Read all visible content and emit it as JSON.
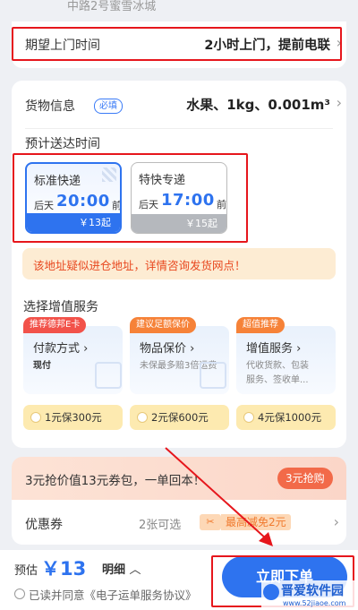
{
  "address_fragment": "中路2号蜜雪冰城",
  "pickup": {
    "label": "期望上门时间",
    "value": "2小时上门，提前电联"
  },
  "goods": {
    "label": "货物信息",
    "required_tag": "必填",
    "value": "水果、1kg、0.001m³"
  },
  "eta_title": "预计送达时间",
  "shipping_options": [
    {
      "name": "标准快递",
      "day": "后天",
      "time": "20:00",
      "suffix": "前",
      "price": "￥13起"
    },
    {
      "name": "特快专递",
      "day": "后天",
      "time": "17:00",
      "suffix": "前",
      "price": "￥15起"
    }
  ],
  "warning": "该地址疑似进仓地址，详情咨询发货网点！",
  "value_added": {
    "title": "选择增值服务",
    "services": [
      {
        "badge": "推荐德邦E卡",
        "title": "付款方式",
        "desc": "现付",
        "option": "1元保300元"
      },
      {
        "badge": "建议足额保价",
        "title": "物品保价",
        "desc": "未保最多赔3倍运费",
        "option": "2元保600元"
      },
      {
        "badge": "超值推荐",
        "title": "增值服务",
        "desc": "代收货款、包装\n服务、签收单...",
        "option": "4元保1000元"
      }
    ]
  },
  "promo": {
    "text": "3元抢价值13元券包，一单回本！",
    "button": "3元抢购"
  },
  "coupon": {
    "label": "优惠券",
    "available": "2张可选",
    "tag": "最高减免2元"
  },
  "bottom": {
    "estimate_label": "预估",
    "price": "￥13",
    "detail": "明细",
    "agreement": "已读并同意《电子运单服务协议》",
    "submit": "立即下单"
  },
  "watermark": {
    "name": "晋爱软件园",
    "url": "www.52jiaoe.com"
  },
  "colors": {
    "accent_blue": "#2e73ef",
    "highlight_red": "#e6161c",
    "warning_bg": "#fdecd3",
    "warning_text": "#e8471e",
    "option_yellow": "#fdeab0"
  }
}
